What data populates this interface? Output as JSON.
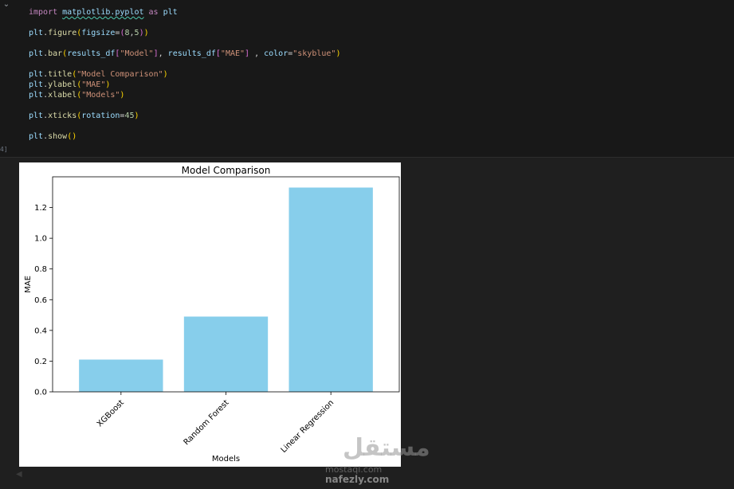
{
  "cell": {
    "gutter_label": "4]",
    "code": [
      [
        {
          "c": "kw",
          "t": "import "
        },
        {
          "c": "mod",
          "t": "matplotlib.pyplot"
        },
        {
          "c": "kw",
          "t": " as "
        },
        {
          "c": "var",
          "t": "plt"
        }
      ],
      [],
      [
        {
          "c": "var",
          "t": "plt"
        },
        {
          "c": "punc",
          "t": "."
        },
        {
          "c": "fn",
          "t": "figure"
        },
        {
          "c": "paren1",
          "t": "("
        },
        {
          "c": "param",
          "t": "figsize"
        },
        {
          "c": "punc",
          "t": "="
        },
        {
          "c": "paren2",
          "t": "("
        },
        {
          "c": "num",
          "t": "8"
        },
        {
          "c": "punc",
          "t": ","
        },
        {
          "c": "num",
          "t": "5"
        },
        {
          "c": "paren2",
          "t": ")"
        },
        {
          "c": "paren1",
          "t": ")"
        }
      ],
      [],
      [
        {
          "c": "var",
          "t": "plt"
        },
        {
          "c": "punc",
          "t": "."
        },
        {
          "c": "fn",
          "t": "bar"
        },
        {
          "c": "paren1",
          "t": "("
        },
        {
          "c": "var",
          "t": "results_df"
        },
        {
          "c": "paren2",
          "t": "["
        },
        {
          "c": "str",
          "t": "\"Model\""
        },
        {
          "c": "paren2",
          "t": "]"
        },
        {
          "c": "punc",
          "t": ", "
        },
        {
          "c": "var",
          "t": "results_df"
        },
        {
          "c": "paren2",
          "t": "["
        },
        {
          "c": "str",
          "t": "\"MAE\""
        },
        {
          "c": "paren2",
          "t": "]"
        },
        {
          "c": "punc",
          "t": " , "
        },
        {
          "c": "param",
          "t": "color"
        },
        {
          "c": "punc",
          "t": "="
        },
        {
          "c": "str",
          "t": "\"skyblue\""
        },
        {
          "c": "paren1",
          "t": ")"
        }
      ],
      [],
      [
        {
          "c": "var",
          "t": "plt"
        },
        {
          "c": "punc",
          "t": "."
        },
        {
          "c": "fn",
          "t": "title"
        },
        {
          "c": "paren1",
          "t": "("
        },
        {
          "c": "str",
          "t": "\"Model Comparison\""
        },
        {
          "c": "paren1",
          "t": ")"
        }
      ],
      [
        {
          "c": "var",
          "t": "plt"
        },
        {
          "c": "punc",
          "t": "."
        },
        {
          "c": "fn",
          "t": "ylabel"
        },
        {
          "c": "paren1",
          "t": "("
        },
        {
          "c": "str",
          "t": "\"MAE\""
        },
        {
          "c": "paren1",
          "t": ")"
        }
      ],
      [
        {
          "c": "var",
          "t": "plt"
        },
        {
          "c": "punc",
          "t": "."
        },
        {
          "c": "fn",
          "t": "xlabel"
        },
        {
          "c": "paren1",
          "t": "("
        },
        {
          "c": "str",
          "t": "\"Models\""
        },
        {
          "c": "paren1",
          "t": ")"
        }
      ],
      [],
      [
        {
          "c": "var",
          "t": "plt"
        },
        {
          "c": "punc",
          "t": "."
        },
        {
          "c": "fn",
          "t": "xticks"
        },
        {
          "c": "paren1",
          "t": "("
        },
        {
          "c": "param",
          "t": "rotation"
        },
        {
          "c": "punc",
          "t": "="
        },
        {
          "c": "num",
          "t": "45"
        },
        {
          "c": "paren1",
          "t": ")"
        }
      ],
      [],
      [
        {
          "c": "var",
          "t": "plt"
        },
        {
          "c": "punc",
          "t": "."
        },
        {
          "c": "fn",
          "t": "show"
        },
        {
          "c": "paren1",
          "t": "()"
        }
      ]
    ]
  },
  "chart_data": {
    "type": "bar",
    "title": "Model Comparison",
    "xlabel": "Models",
    "ylabel": "MAE",
    "categories": [
      "XGBoost",
      "Random Forest",
      "Linear Regression"
    ],
    "values": [
      0.21,
      0.49,
      1.33
    ],
    "ylim": [
      0,
      1.4
    ],
    "yticks": [
      0.0,
      0.2,
      0.4,
      0.6,
      0.8,
      1.0,
      1.2
    ],
    "ytick_labels": [
      "0.0",
      "0.2",
      "0.4",
      "0.6",
      "0.8",
      "1.0",
      "1.2"
    ],
    "xtick_rotation": 45,
    "bar_color": "#87ceeb",
    "grid": false
  },
  "watermark": {
    "logo_text": "مستقل",
    "line1": "mostaql.com",
    "line2": "nafezly.com"
  },
  "icons": {
    "chevron": "chevron-down-icon",
    "scroll": "scroll-left-icon"
  }
}
